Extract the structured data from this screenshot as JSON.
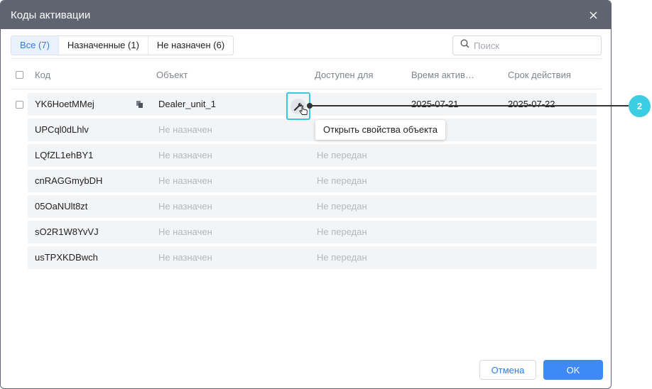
{
  "dialog": {
    "title": "Коды активации"
  },
  "tabs": [
    {
      "label": "Все (7)",
      "active": true
    },
    {
      "label": "Назначенные (1)",
      "active": false
    },
    {
      "label": "Не назначен (6)",
      "active": false
    }
  ],
  "search": {
    "placeholder": "Поиск",
    "value": ""
  },
  "columns": {
    "code": "Код",
    "object": "Объект",
    "available_for": "Доступен для",
    "activation_time": "Время актив…",
    "validity": "Срок действия"
  },
  "rows": [
    {
      "code": "YK6HoetMMej",
      "object": "Dealer_unit_1",
      "available_for": "",
      "activation_time": "2025-07-21",
      "validity": "2025-07-22"
    },
    {
      "code": "UPCql0dLhlv",
      "object": "Не назначен",
      "available_for": "",
      "activation_time": "",
      "validity": ""
    },
    {
      "code": "LQfZL1ehBY1",
      "object": "Не назначен",
      "available_for": "Не передан",
      "activation_time": "",
      "validity": ""
    },
    {
      "code": "cnRAGGmybDH",
      "object": "Не назначен",
      "available_for": "Не передан",
      "activation_time": "",
      "validity": ""
    },
    {
      "code": "05OaNUlt8zt",
      "object": "Не назначен",
      "available_for": "Не передан",
      "activation_time": "",
      "validity": ""
    },
    {
      "code": "sO2R1W8YvVJ",
      "object": "Не назначен",
      "available_for": "Не передан",
      "activation_time": "",
      "validity": ""
    },
    {
      "code": "usTPXKDBwch",
      "object": "Не назначен",
      "available_for": "Не передан",
      "activation_time": "",
      "validity": ""
    }
  ],
  "tooltip": {
    "text": "Открыть свойства объекта"
  },
  "callout": {
    "number": "2"
  },
  "footer": {
    "cancel_label": "Отмена",
    "ok_label": "OK"
  },
  "icons": {
    "close": "close-icon",
    "search": "search-icon",
    "copy": "copy-icon",
    "wrench": "wrench-icon",
    "cursor": "pointer-cursor-icon"
  },
  "colors": {
    "titlebar": "#5f6470",
    "accent": "#2b7de9",
    "primary_button": "#3d8af7",
    "highlight": "#38c8e0",
    "callout": "#3dcde3",
    "row_bg": "#f3f4f6"
  }
}
